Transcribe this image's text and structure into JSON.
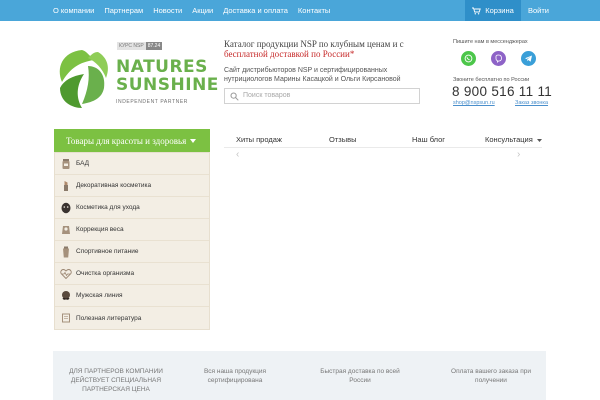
{
  "topnav": {
    "links": [
      "О компании",
      "Партнерам",
      "Новости",
      "Акции",
      "Доставка и оплата",
      "Контакты"
    ],
    "cart_label": "Корзина",
    "login_label": "Войти"
  },
  "logo": {
    "line1": "NATURES",
    "line2": "SUNSHINE",
    "subtitle": "INDEPENDENT PARTNER",
    "rate_label": "КУРС NSP",
    "rate_value": "87.24"
  },
  "header": {
    "catalog_line1": "Каталог продукции NSP по клубным ценам и с",
    "catalog_line2": "бесплатной доставкой по России*",
    "distrib_text": "Сайт дистрибьюторов NSP и сертифицированных нутрициологов Марины Касацкой и Ольги Кирсановой",
    "search_placeholder": "Поиск товаров"
  },
  "contacts": {
    "messengers_title": "Пишите нам в мессенджерах",
    "free_call_title": "Звоните бесплатно по России",
    "phone": "8 900 516 11 11",
    "email": "shop@nspsun.ru",
    "callback": "Заказ звонка"
  },
  "sidebar": {
    "title": "Товары для красоты и здоровья",
    "items": [
      {
        "label": "БАД",
        "icon": "pill-bottle-icon"
      },
      {
        "label": "Декоративная косметика",
        "icon": "lipstick-icon"
      },
      {
        "label": "Косметика для ухода",
        "icon": "face-mask-icon"
      },
      {
        "label": "Коррекция веса",
        "icon": "scale-icon"
      },
      {
        "label": "Спортивное питание",
        "icon": "shaker-icon"
      },
      {
        "label": "Очистка организма",
        "icon": "heartbeat-icon"
      },
      {
        "label": "Мужская линия",
        "icon": "mustache-icon"
      },
      {
        "label": "Полезная литература",
        "icon": "book-icon"
      }
    ]
  },
  "tabs": [
    "Хиты продаж",
    "Отзывы",
    "Наш блог",
    "Консультация"
  ],
  "features": [
    {
      "text": "ДЛЯ ПАРТНЕРОВ КОМПАНИИ ДЕЙСТВУЕТ СПЕЦИАЛЬНАЯ ПАРТНЕРСКАЯ ЦЕНА"
    },
    {
      "text": "Вся наша продукция сертифицирована"
    },
    {
      "text": "Быстрая доставка по всей России"
    },
    {
      "text": "Оплата вашего заказа при получении"
    }
  ],
  "colors": {
    "nav_blue": "#4aa6d9",
    "cart_blue": "#2f8fc9",
    "brand_green": "#7cc142",
    "accent_red": "#c62828"
  }
}
